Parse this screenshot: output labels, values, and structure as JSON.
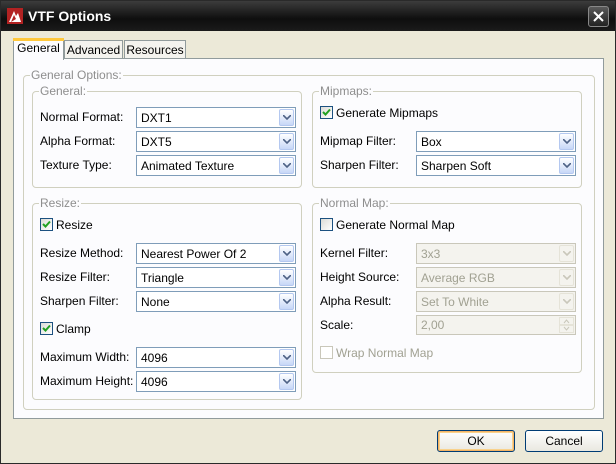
{
  "window": {
    "title": "VTF Options"
  },
  "tabs": [
    {
      "label": "General",
      "active": true
    },
    {
      "label": "Advanced",
      "active": false
    },
    {
      "label": "Resources",
      "active": false
    }
  ],
  "general_options": {
    "label": "General Options:",
    "general": {
      "label": "General:",
      "normal_format": {
        "label": "Normal Format:",
        "value": "DXT1"
      },
      "alpha_format": {
        "label": "Alpha Format:",
        "value": "DXT5"
      },
      "texture_type": {
        "label": "Texture Type:",
        "value": "Animated Texture"
      }
    },
    "mipmaps": {
      "label": "Mipmaps:",
      "generate": {
        "label": "Generate Mipmaps",
        "checked": true
      },
      "mipmap_filter": {
        "label": "Mipmap Filter:",
        "value": "Box"
      },
      "sharpen_filter": {
        "label": "Sharpen Filter:",
        "value": "Sharpen Soft"
      }
    },
    "resize": {
      "label": "Resize:",
      "resize": {
        "label": "Resize",
        "checked": true
      },
      "method": {
        "label": "Resize Method:",
        "value": "Nearest Power Of 2"
      },
      "filter": {
        "label": "Resize Filter:",
        "value": "Triangle"
      },
      "sharpen": {
        "label": "Sharpen Filter:",
        "value": "None"
      },
      "clamp": {
        "label": "Clamp",
        "checked": true
      },
      "max_width": {
        "label": "Maximum Width:",
        "value": "4096"
      },
      "max_height": {
        "label": "Maximum Height:",
        "value": "4096"
      }
    },
    "normal_map": {
      "label": "Normal Map:",
      "generate": {
        "label": "Generate Normal Map",
        "checked": false
      },
      "kernel_filter": {
        "label": "Kernel Filter:",
        "value": "3x3"
      },
      "height_source": {
        "label": "Height Source:",
        "value": "Average RGB"
      },
      "alpha_result": {
        "label": "Alpha Result:",
        "value": "Set To White"
      },
      "scale": {
        "label": "Scale:",
        "value": "2,00"
      },
      "wrap": {
        "label": "Wrap Normal Map",
        "checked": false
      }
    }
  },
  "buttons": {
    "ok": "OK",
    "cancel": "Cancel"
  }
}
